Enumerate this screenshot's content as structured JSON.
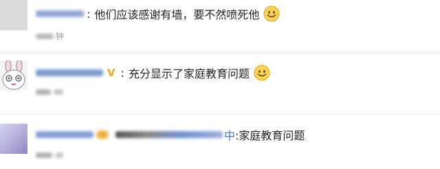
{
  "comments": [
    {
      "text": "他们应该感谢有墙，要不然喷死他",
      "separator": ":",
      "emoji": "smile-emoji",
      "sub_tag": "钟"
    },
    {
      "text": "充分显示了家庭教育问题",
      "badge": "V",
      "separator": ":",
      "emoji": "smile-emoji"
    },
    {
      "highlight": "中",
      "text": ":家庭教育问题"
    }
  ],
  "colors": {
    "divider": "#e6e6e6",
    "vip_badge": "#f2a81d",
    "username_blur": "#2f6fd6",
    "emoji_face": "#ffd34d"
  }
}
